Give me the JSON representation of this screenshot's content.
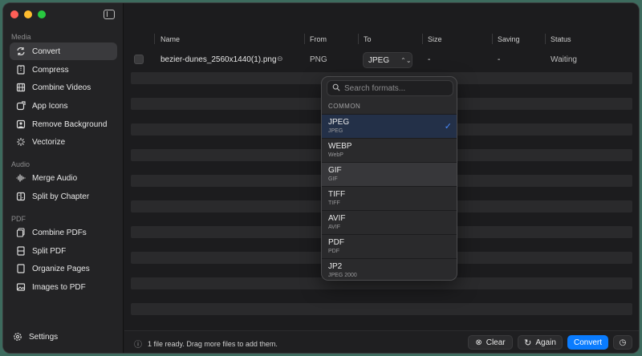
{
  "sidebar": {
    "sections": [
      {
        "label": "Media",
        "items": [
          "Convert",
          "Compress",
          "Combine Videos",
          "App Icons",
          "Remove Background",
          "Vectorize"
        ]
      },
      {
        "label": "Audio",
        "items": [
          "Merge Audio",
          "Split by Chapter"
        ]
      },
      {
        "label": "PDF",
        "items": [
          "Combine PDFs",
          "Split PDF",
          "Organize Pages",
          "Images to PDF"
        ]
      }
    ],
    "settings_label": "Settings"
  },
  "table": {
    "headers": {
      "name": "Name",
      "from": "From",
      "to": "To",
      "size": "Size",
      "saving": "Saving",
      "status": "Status"
    },
    "row": {
      "name": "bezier-dunes_2560x1440(1).png",
      "from": "PNG",
      "to": "JPEG",
      "size": "-",
      "saving": "-",
      "status": "Waiting"
    }
  },
  "dropdown": {
    "search_placeholder": "Search formats...",
    "group": "COMMON",
    "formats": [
      {
        "name": "JPEG",
        "sub": "JPEG",
        "selected": true
      },
      {
        "name": "WEBP",
        "sub": "WebP"
      },
      {
        "name": "GIF",
        "sub": "GIF"
      },
      {
        "name": "TIFF",
        "sub": "TIFF"
      },
      {
        "name": "AVIF",
        "sub": "AVIF"
      },
      {
        "name": "PDF",
        "sub": "PDF"
      },
      {
        "name": "JP2",
        "sub": "JPEG 2000"
      }
    ],
    "check_mark": "✓"
  },
  "footer": {
    "status": "1 file ready. Drag more files to add them.",
    "clear_label": "Clear",
    "again_label": "Again",
    "convert_label": "Convert"
  },
  "colors": {
    "accent": "#0a7cff",
    "selected_row": "#233048"
  }
}
